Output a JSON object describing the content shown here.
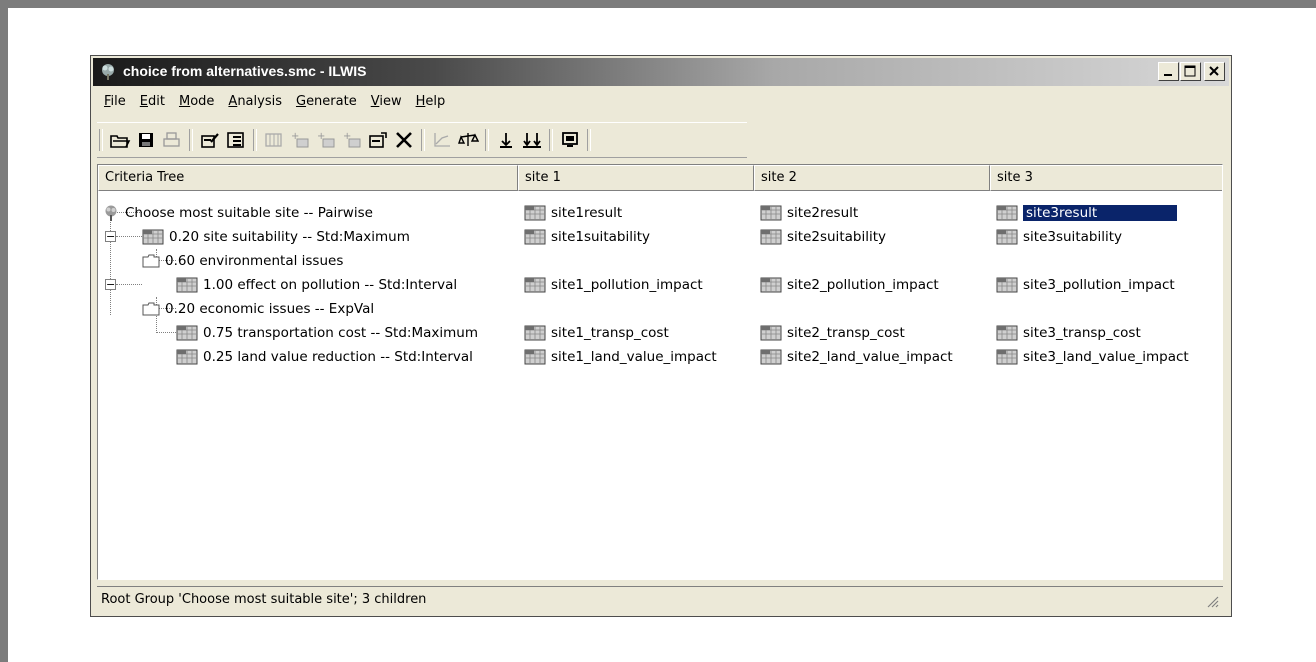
{
  "window": {
    "title": "choice from alternatives.smc - ILWIS"
  },
  "menu": [
    {
      "key": "F",
      "rest": "ile"
    },
    {
      "key": "E",
      "rest": "dit"
    },
    {
      "key": "M",
      "rest": "ode"
    },
    {
      "key": "A",
      "rest": "nalysis"
    },
    {
      "key": "G",
      "rest": "enerate"
    },
    {
      "key": "V",
      "rest": "iew"
    },
    {
      "key": "H",
      "rest": "elp"
    }
  ],
  "columns": [
    "Criteria Tree",
    "site 1",
    "site 2",
    "site 3"
  ],
  "rows": [
    {
      "label": "Choose most suitable site -- Pairwise",
      "site1": "site1result",
      "site2": "site2result",
      "site3": "site3result"
    },
    {
      "label": "0.20 site suitability -- Std:Maximum",
      "site1": "site1suitability",
      "site2": "site2suitability",
      "site3": "site3suitability"
    },
    {
      "label": "0.60 environmental issues",
      "site1": "",
      "site2": "",
      "site3": ""
    },
    {
      "label": "1.00 effect on pollution -- Std:Interval",
      "site1": "site1_pollution_impact",
      "site2": "site2_pollution_impact",
      "site3": "site3_pollution_impact"
    },
    {
      "label": "0.20 economic issues -- ExpVal",
      "site1": "",
      "site2": "",
      "site3": ""
    },
    {
      "label": "0.75 transportation cost -- Std:Maximum",
      "site1": "site1_transp_cost",
      "site2": "site2_transp_cost",
      "site3": "site3_transp_cost"
    },
    {
      "label": "0.25 land value reduction -- Std:Interval",
      "site1": "site1_land_value_impact",
      "site2": "site2_land_value_impact",
      "site3": "site3_land_value_impact"
    }
  ],
  "status": "Root Group 'Choose most suitable site'; 3 children"
}
